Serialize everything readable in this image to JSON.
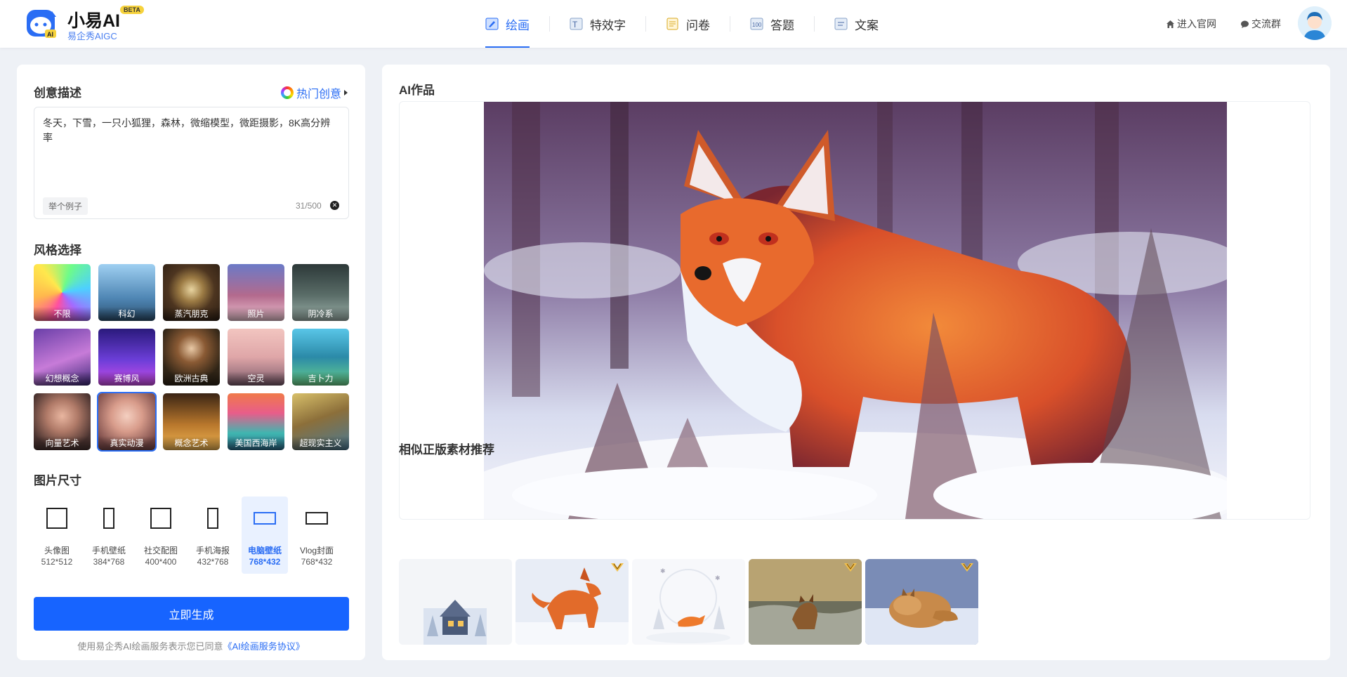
{
  "brand": {
    "title": "小易AI",
    "badge": "BETA",
    "subtitle": "易企秀AIGC"
  },
  "nav": [
    {
      "label": "绘画",
      "icon": "paint-icon",
      "active": true
    },
    {
      "label": "特效字",
      "icon": "text-effect-icon",
      "active": false
    },
    {
      "label": "问卷",
      "icon": "survey-icon",
      "active": false
    },
    {
      "label": "答题",
      "icon": "quiz-icon",
      "active": false
    },
    {
      "label": "文案",
      "icon": "copywriting-icon",
      "active": false
    }
  ],
  "header_links": {
    "official": "进入官网",
    "group": "交流群"
  },
  "prompt": {
    "title": "创意描述",
    "hot_label": "热门创意",
    "value": "冬天，下雪，一只小狐狸，森林，微缩模型，微距摄影，8K高分辨率",
    "example_label": "举个例子",
    "count": "31/500"
  },
  "styles": {
    "title": "风格选择",
    "items": [
      "不限",
      "科幻",
      "蒸汽朋克",
      "照片",
      "阴冷系",
      "幻想概念",
      "赛博风",
      "欧洲古典",
      "空灵",
      "吉卜力",
      "向量艺术",
      "真实动漫",
      "概念艺术",
      "美国西海岸",
      "超现实主义"
    ],
    "selected": "真实动漫"
  },
  "sizes": {
    "title": "图片尺寸",
    "items": [
      {
        "name": "头像图",
        "dim": "512*512"
      },
      {
        "name": "手机壁纸",
        "dim": "384*768"
      },
      {
        "name": "社交配图",
        "dim": "400*400"
      },
      {
        "name": "手机海报",
        "dim": "432*768"
      },
      {
        "name": "电脑壁纸",
        "dim": "768*432"
      },
      {
        "name": "Vlog封面",
        "dim": "768*432"
      }
    ],
    "selected": "电脑壁纸"
  },
  "generate_label": "立即生成",
  "agreement": {
    "prefix": "使用易企秀AI绘画服务表示您已同意",
    "link": "《AI绘画服务协议》"
  },
  "result": {
    "title": "AI作品"
  },
  "recommend": {
    "title": "相似正版素材推荐"
  },
  "colors": {
    "accent": "#2a6df4",
    "button": "#1764ff",
    "beta_badge": "#f6d23c"
  }
}
